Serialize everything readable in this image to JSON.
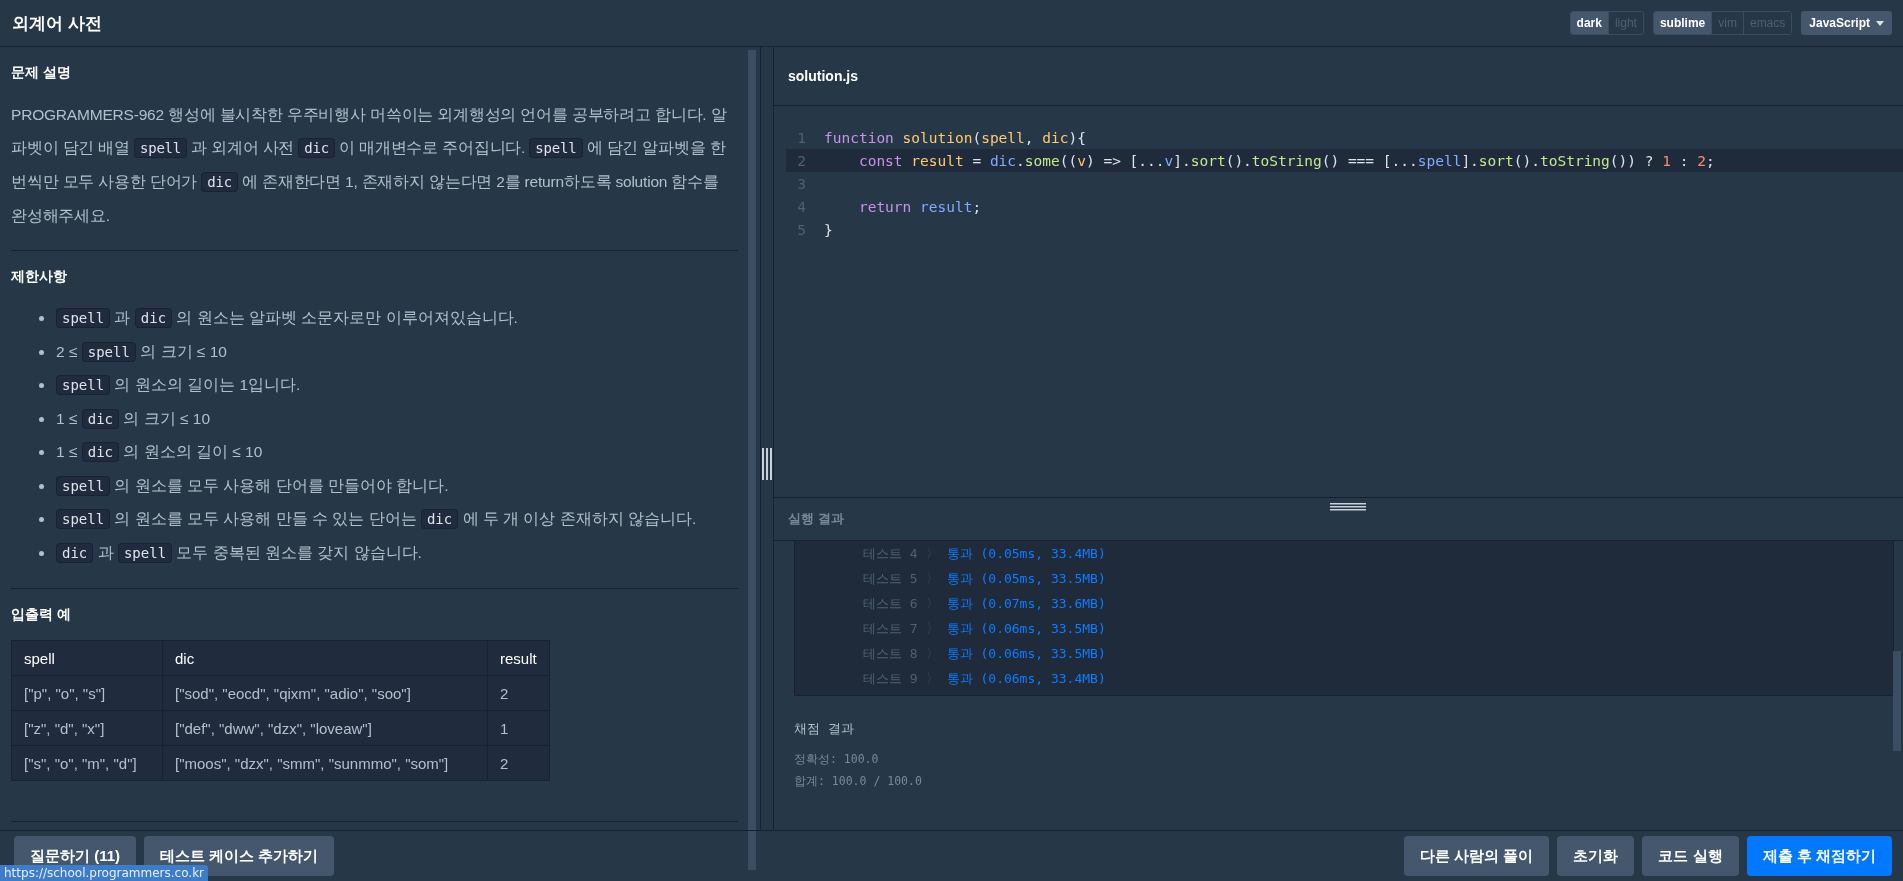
{
  "header": {
    "title": "외계어 사전",
    "theme_toggle": [
      {
        "label": "dark",
        "selected": true
      },
      {
        "label": "light",
        "selected": false
      }
    ],
    "keymap_toggle": [
      {
        "label": "sublime",
        "selected": true
      },
      {
        "label": "vim",
        "selected": false
      },
      {
        "label": "emacs",
        "selected": false
      }
    ],
    "language": "JavaScript"
  },
  "problem": {
    "heading": "문제 설명",
    "paragraph": [
      {
        "kind": "text",
        "text": "PROGRAMMERS-962 행성에 불시착한 우주비행사 머쓱이는 외계행성의 언어를 공부하려고 합니다. 알파벳이 담긴 배열 "
      },
      {
        "kind": "code",
        "text": "spell"
      },
      {
        "kind": "text",
        "text": " 과 외계어 사전 "
      },
      {
        "kind": "code",
        "text": "dic"
      },
      {
        "kind": "text",
        "text": " 이 매개변수로 주어집니다. "
      },
      {
        "kind": "code",
        "text": "spell"
      },
      {
        "kind": "text",
        "text": " 에 담긴 알파벳을 한번씩만 모두 사용한 단어가 "
      },
      {
        "kind": "code",
        "text": "dic"
      },
      {
        "kind": "text",
        "text": " 에 존재한다면 1, 존재하지 않는다면 2를 return하도록 solution 함수를 완성해주세요."
      }
    ]
  },
  "constraints": {
    "heading": "제한사항",
    "items": [
      [
        {
          "kind": "code",
          "text": "spell"
        },
        {
          "kind": "text",
          "text": " 과 "
        },
        {
          "kind": "code",
          "text": "dic"
        },
        {
          "kind": "text",
          "text": " 의 원소는 알파벳 소문자로만 이루어져있습니다."
        }
      ],
      [
        {
          "kind": "text",
          "text": "2 ≤ "
        },
        {
          "kind": "code",
          "text": "spell"
        },
        {
          "kind": "text",
          "text": " 의 크기 ≤ 10"
        }
      ],
      [
        {
          "kind": "code",
          "text": "spell"
        },
        {
          "kind": "text",
          "text": " 의 원소의 길이는 1입니다."
        }
      ],
      [
        {
          "kind": "text",
          "text": "1 ≤ "
        },
        {
          "kind": "code",
          "text": "dic"
        },
        {
          "kind": "text",
          "text": " 의 크기 ≤ 10"
        }
      ],
      [
        {
          "kind": "text",
          "text": "1 ≤ "
        },
        {
          "kind": "code",
          "text": "dic"
        },
        {
          "kind": "text",
          "text": " 의 원소의 길이 ≤ 10"
        }
      ],
      [
        {
          "kind": "code",
          "text": "spell"
        },
        {
          "kind": "text",
          "text": " 의 원소를 모두 사용해 단어를 만들어야 합니다."
        }
      ],
      [
        {
          "kind": "code",
          "text": "spell"
        },
        {
          "kind": "text",
          "text": " 의 원소를 모두 사용해 만들 수 있는 단어는 "
        },
        {
          "kind": "code",
          "text": "dic"
        },
        {
          "kind": "text",
          "text": " 에 두 개 이상 존재하지 않습니다."
        }
      ],
      [
        {
          "kind": "code",
          "text": "dic"
        },
        {
          "kind": "text",
          "text": " 과 "
        },
        {
          "kind": "code",
          "text": "spell"
        },
        {
          "kind": "text",
          "text": " 모두 중복된 원소를 갖지 않습니다."
        }
      ]
    ]
  },
  "examples": {
    "heading": "입출력 예",
    "table": {
      "columns": [
        "spell",
        "dic",
        "result"
      ],
      "rows": [
        [
          "[\"p\", \"o\", \"s\"]",
          "[\"sod\", \"eocd\", \"qixm\", \"adio\", \"soo\"]",
          "2"
        ],
        [
          "[\"z\", \"d\", \"x\"]",
          "[\"def\", \"dww\", \"dzx\", \"loveaw\"]",
          "1"
        ],
        [
          "[\"s\", \"o\", \"m\", \"d\"]",
          "[\"moos\", \"dzx\", \"smm\", \"sunmmo\", \"som\"]",
          "2"
        ]
      ]
    }
  },
  "editor": {
    "file_name": "solution.js",
    "lines": [
      {
        "number": "1",
        "active": false,
        "tokens": [
          {
            "kind": "keyword",
            "text": "function"
          },
          {
            "kind": "def",
            "text": " solution"
          },
          {
            "kind": "plain",
            "text": "("
          },
          {
            "kind": "def",
            "text": "spell"
          },
          {
            "kind": "plain",
            "text": ", "
          },
          {
            "kind": "def",
            "text": "dic"
          },
          {
            "kind": "plain",
            "text": "){"
          }
        ]
      },
      {
        "number": "2",
        "active": true,
        "tokens": [
          {
            "kind": "keyword",
            "text": "    const"
          },
          {
            "kind": "def",
            "text": " result"
          },
          {
            "kind": "plain",
            "text": " = "
          },
          {
            "kind": "var",
            "text": "dic"
          },
          {
            "kind": "plain",
            "text": "."
          },
          {
            "kind": "prop",
            "text": "some"
          },
          {
            "kind": "plain",
            "text": "(("
          },
          {
            "kind": "def",
            "text": "v"
          },
          {
            "kind": "plain",
            "text": ") => [..."
          },
          {
            "kind": "var",
            "text": "v"
          },
          {
            "kind": "plain",
            "text": "]."
          },
          {
            "kind": "prop",
            "text": "sort"
          },
          {
            "kind": "plain",
            "text": "()."
          },
          {
            "kind": "prop",
            "text": "toString"
          },
          {
            "kind": "plain",
            "text": "() === [..."
          },
          {
            "kind": "var",
            "text": "spell"
          },
          {
            "kind": "plain",
            "text": "]."
          },
          {
            "kind": "prop",
            "text": "sort"
          },
          {
            "kind": "plain",
            "text": "()."
          },
          {
            "kind": "prop",
            "text": "toString"
          },
          {
            "kind": "plain",
            "text": "()) ? "
          },
          {
            "kind": "number",
            "text": "1"
          },
          {
            "kind": "plain",
            "text": " : "
          },
          {
            "kind": "number",
            "text": "2"
          },
          {
            "kind": "plain",
            "text": ";"
          }
        ]
      },
      {
        "number": "3",
        "active": false
      },
      {
        "number": "4",
        "active": false,
        "tokens": [
          {
            "kind": "keyword",
            "text": "    return"
          },
          {
            "kind": "var",
            "text": " result"
          },
          {
            "kind": "plain",
            "text": ";"
          }
        ]
      },
      {
        "number": "5",
        "active": false,
        "tokens": [
          {
            "kind": "plain",
            "text": "}"
          }
        ]
      }
    ]
  },
  "run_result": {
    "heading": "실행 결과",
    "tests": [
      {
        "label": "테스트 4",
        "separator": "〉",
        "result": "통과 (0.05ms, 33.4MB)"
      },
      {
        "label": "테스트 5",
        "separator": "〉",
        "result": "통과 (0.05ms, 33.5MB)"
      },
      {
        "label": "테스트 6",
        "separator": "〉",
        "result": "통과 (0.07ms, 33.6MB)"
      },
      {
        "label": "테스트 7",
        "separator": "〉",
        "result": "통과 (0.06ms, 33.5MB)"
      },
      {
        "label": "테스트 8",
        "separator": "〉",
        "result": "통과 (0.06ms, 33.5MB)"
      },
      {
        "label": "테스트 9",
        "separator": "〉",
        "result": "통과 (0.06ms, 33.4MB)"
      }
    ],
    "grading_heading": "채점 결과",
    "accuracy": "정확성: 100.0",
    "total": "합계: 100.0 / 100.0"
  },
  "footer": {
    "left_buttons": [
      "질문하기 (11)",
      "테스트 케이스 추가하기"
    ],
    "right_buttons": [
      {
        "label": "다른 사람의 풀이",
        "primary": false
      },
      {
        "label": "초기화",
        "primary": false
      },
      {
        "label": "코드 실행",
        "primary": false
      },
      {
        "label": "제출 후 채점하기",
        "primary": true
      }
    ]
  },
  "status_url": "https://school.programmers.co.kr"
}
